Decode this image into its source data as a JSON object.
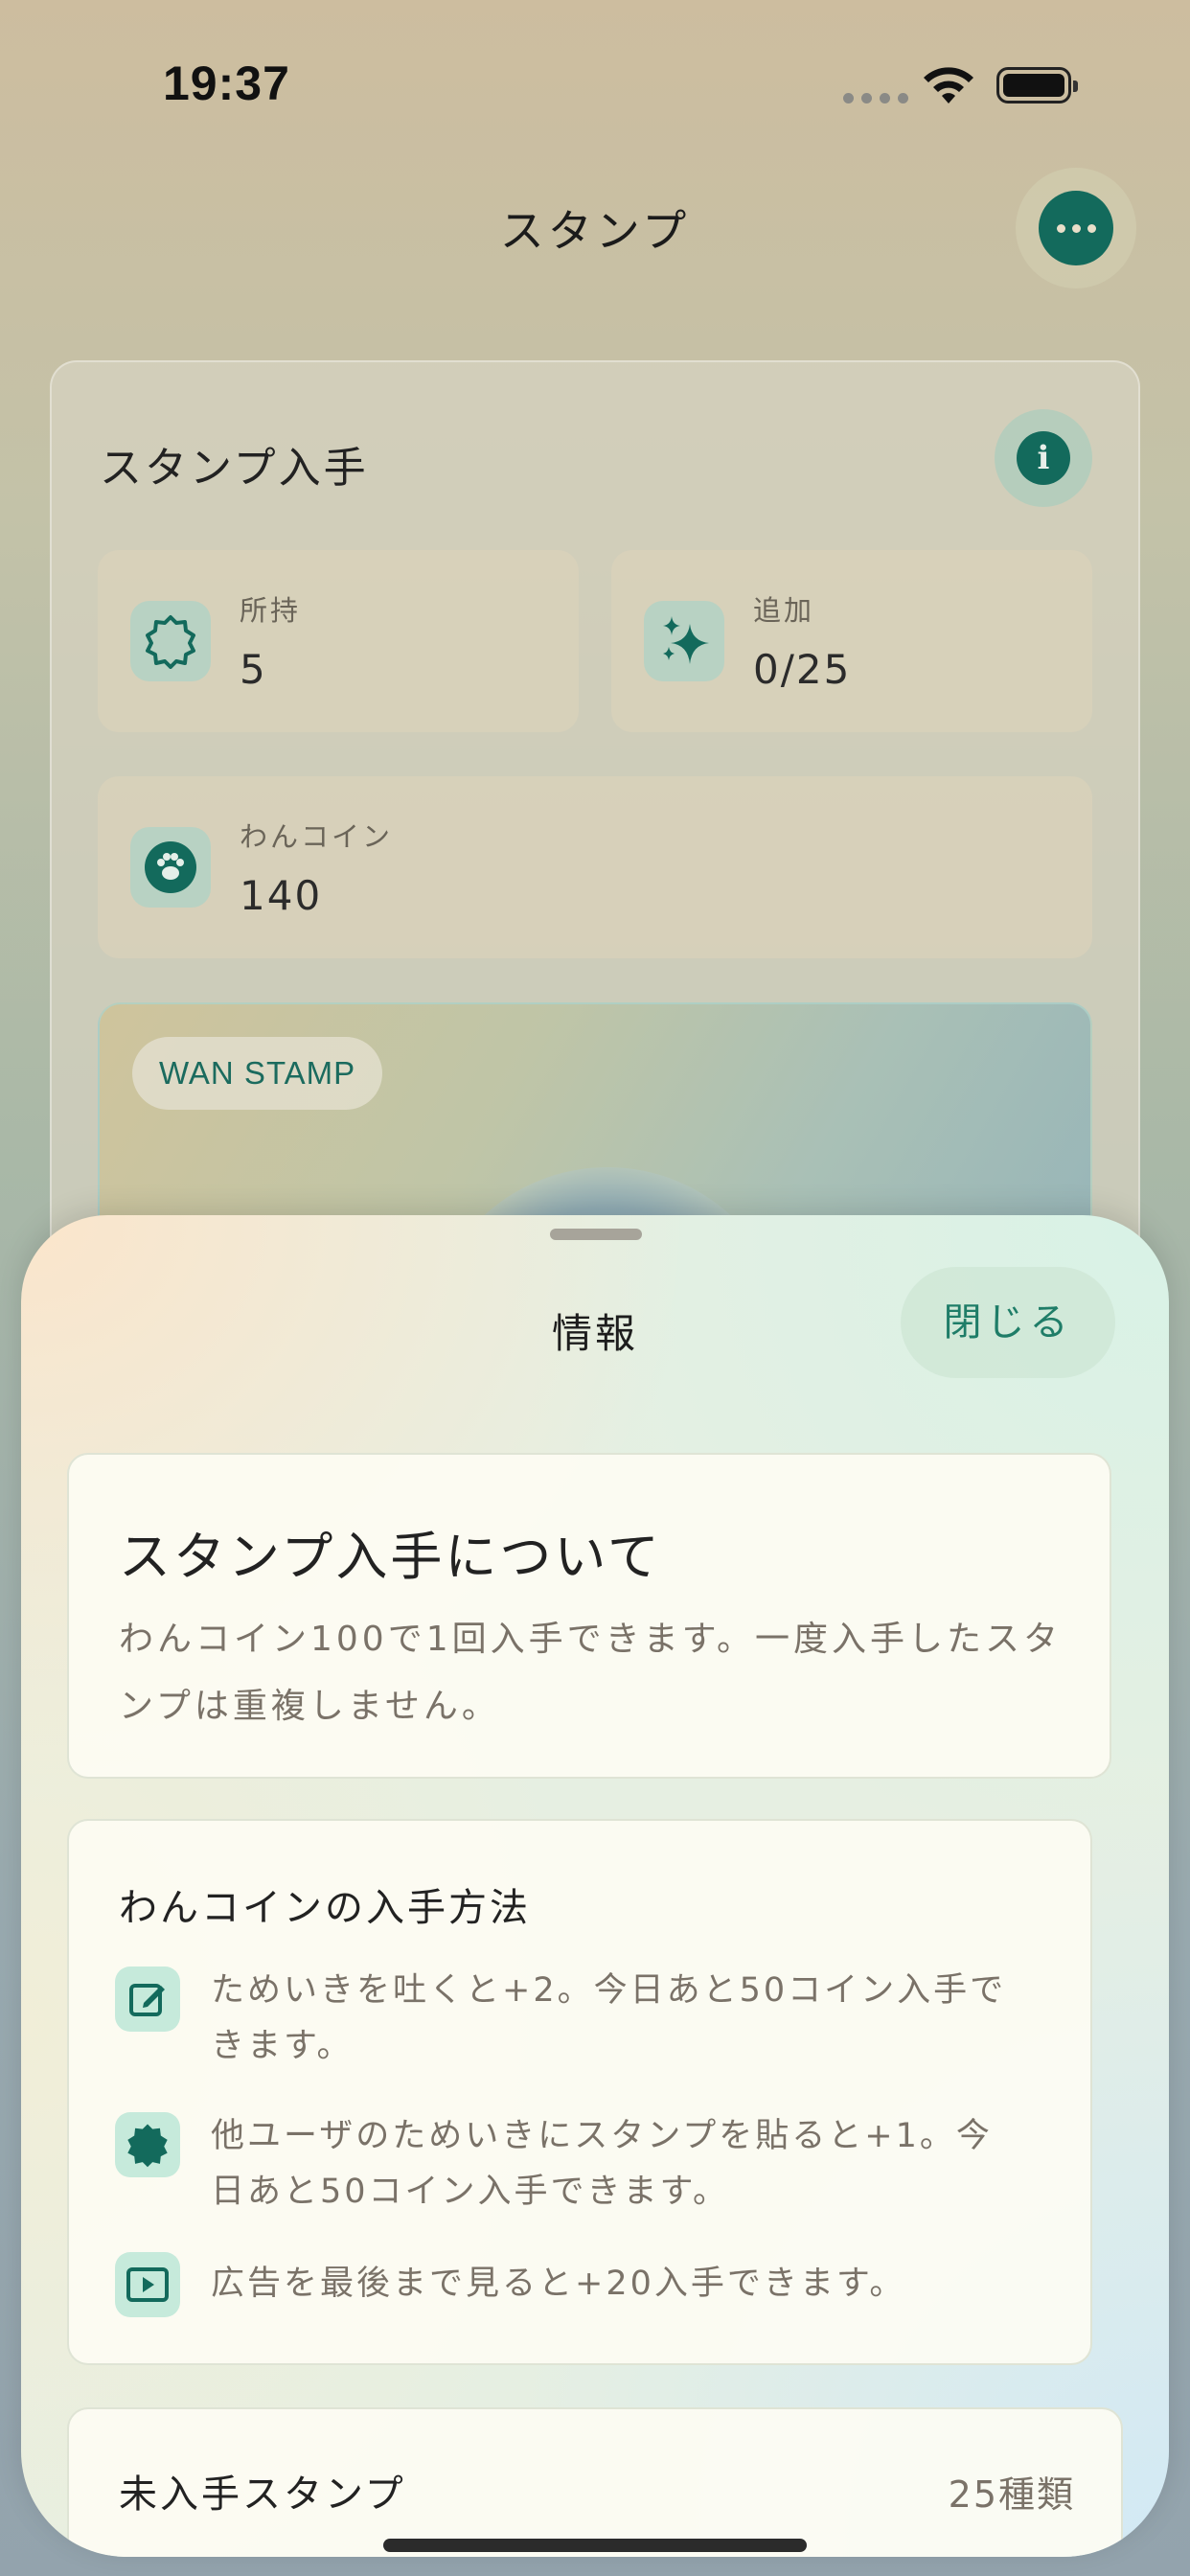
{
  "status_bar": {
    "time": "19:37"
  },
  "nav": {
    "title": "スタンプ"
  },
  "card": {
    "title": "スタンプ入手",
    "stats": [
      {
        "label": "所持",
        "value": "5",
        "icon": "stamp-badge-icon"
      },
      {
        "label": "追加",
        "value": "0/25",
        "icon": "sparkles-icon"
      },
      {
        "label": "わんコイン",
        "value": "140",
        "icon": "paw-icon"
      }
    ],
    "hero": {
      "badge": "WAN STAMP"
    }
  },
  "sheet": {
    "title": "情報",
    "close_label": "閉じる",
    "about": {
      "title": "スタンプ入手について",
      "body_line1": "わんコイン100で1回入手できます。一度入手したスタ",
      "body_line2": "ンプは重複しません。"
    },
    "methods": {
      "title": "わんコインの入手方法",
      "items": [
        {
          "icon": "edit-icon",
          "line1": "ためいきを吐くと+2。今日あと50コイン入手で",
          "line2": "きます。"
        },
        {
          "icon": "stamp-badge-icon",
          "line1": "他ユーザのためいきにスタンプを貼ると+1。今",
          "line2": "日あと50コイン入手できます。"
        },
        {
          "icon": "play-video-icon",
          "line1": "広告を最後まで見ると+20入手できます。",
          "line2": ""
        }
      ]
    },
    "unowned": {
      "label": "未入手スタンプ",
      "count": "25種類"
    }
  },
  "colors": {
    "accent": "#136a5c",
    "accent_text": "#1f7d68",
    "icon_bg": "#c6eadb"
  }
}
